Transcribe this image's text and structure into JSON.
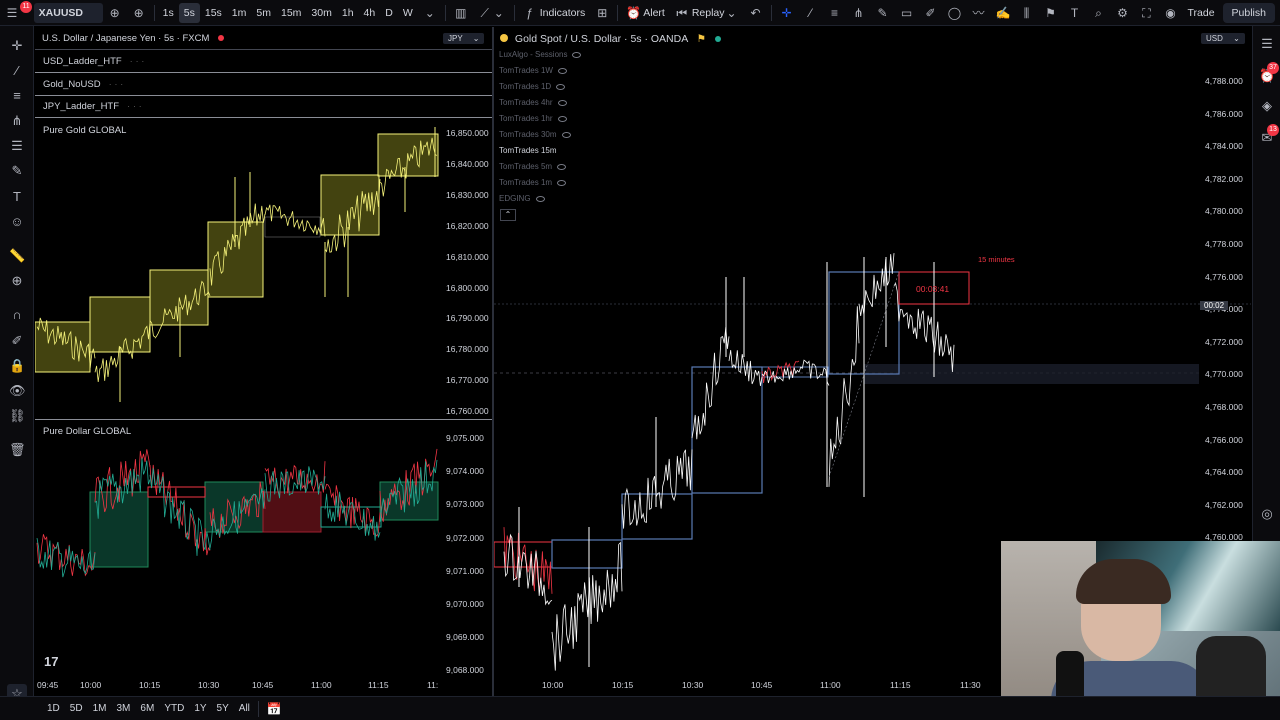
{
  "topbar": {
    "symbol": "XAUUSD",
    "badge_count": "11",
    "timeframes": [
      "1s",
      "5s",
      "15s",
      "1m",
      "5m",
      "15m",
      "30m",
      "1h",
      "4h",
      "D",
      "W"
    ],
    "active_timeframe": "5s",
    "indicators_label": "Indicators",
    "alert_label": "Alert",
    "replay_label": "Replay",
    "trade_label": "Trade",
    "publish_label": "Publish"
  },
  "left_chart": {
    "title": "U.S. Dollar / Japanese Yen · 5s · FXCM",
    "currency": "JPY",
    "sub_panels": [
      "USD_Ladder_HTF",
      "Gold_NoUSD",
      "JPY_Ladder_HTF"
    ],
    "pure_gold_label": "Pure Gold GLOBAL",
    "pure_gold_axis": [
      "16,850.000",
      "16,840.000",
      "16,830.000",
      "16,820.000",
      "16,810.000",
      "16,800.000",
      "16,790.000",
      "16,780.000",
      "16,770.000",
      "16,760.000"
    ],
    "pure_dollar_label": "Pure Dollar GLOBAL",
    "pure_dollar_axis": [
      "9,075.000",
      "9,074.000",
      "9,073.000",
      "9,072.000",
      "9,071.000",
      "9,070.000",
      "9,069.000",
      "9,068.000"
    ],
    "time_axis": [
      "09:45",
      "10:00",
      "10:15",
      "10:30",
      "10:45",
      "11:00",
      "11:15",
      "11:"
    ]
  },
  "right_chart": {
    "title": "Gold Spot / U.S. Dollar · 5s · OANDA",
    "currency": "USD",
    "indicators": [
      "LuxAlgo - Sessions",
      "TomTrades 1W",
      "TomTrades 1D",
      "TomTrades 4hr",
      "TomTrades 1hr",
      "TomTrades 30m",
      "TomTrades 15m",
      "TomTrades 5m",
      "TomTrades 1m",
      "EDGING"
    ],
    "highlight_indicator": "TomTrades 15m",
    "price_axis": [
      "4,788.000",
      "4,786.000",
      "4,784.000",
      "4,782.000",
      "4,780.000",
      "4,778.000",
      "4,776.000",
      "4,774.000",
      "4,772.000",
      "4,770.000",
      "4,768.000",
      "4,766.000",
      "4,764.000",
      "4,762.000",
      "4,760.000"
    ],
    "price_tag": "00:02",
    "countdown": "00:03:41",
    "box_label": "15 minutes",
    "time_axis": [
      "10:00",
      "10:15",
      "10:30",
      "10:45",
      "11:00",
      "11:15",
      "11:30"
    ]
  },
  "bottombar": {
    "ranges": [
      "1D",
      "5D",
      "1M",
      "3M",
      "6M",
      "YTD",
      "1Y",
      "5Y",
      "All"
    ]
  },
  "rightbar": {
    "badge_alerts": "37",
    "badge_chat": "13"
  },
  "colors": {
    "gold_candle": "#f5f27a",
    "gold_box_fill": "#7a7a1e",
    "green_box": "#0b3d2e",
    "red_box": "#5a1016",
    "blue_box": "#5b7bb5",
    "red_accent": "#f23645",
    "white_candle": "#ffffff"
  }
}
